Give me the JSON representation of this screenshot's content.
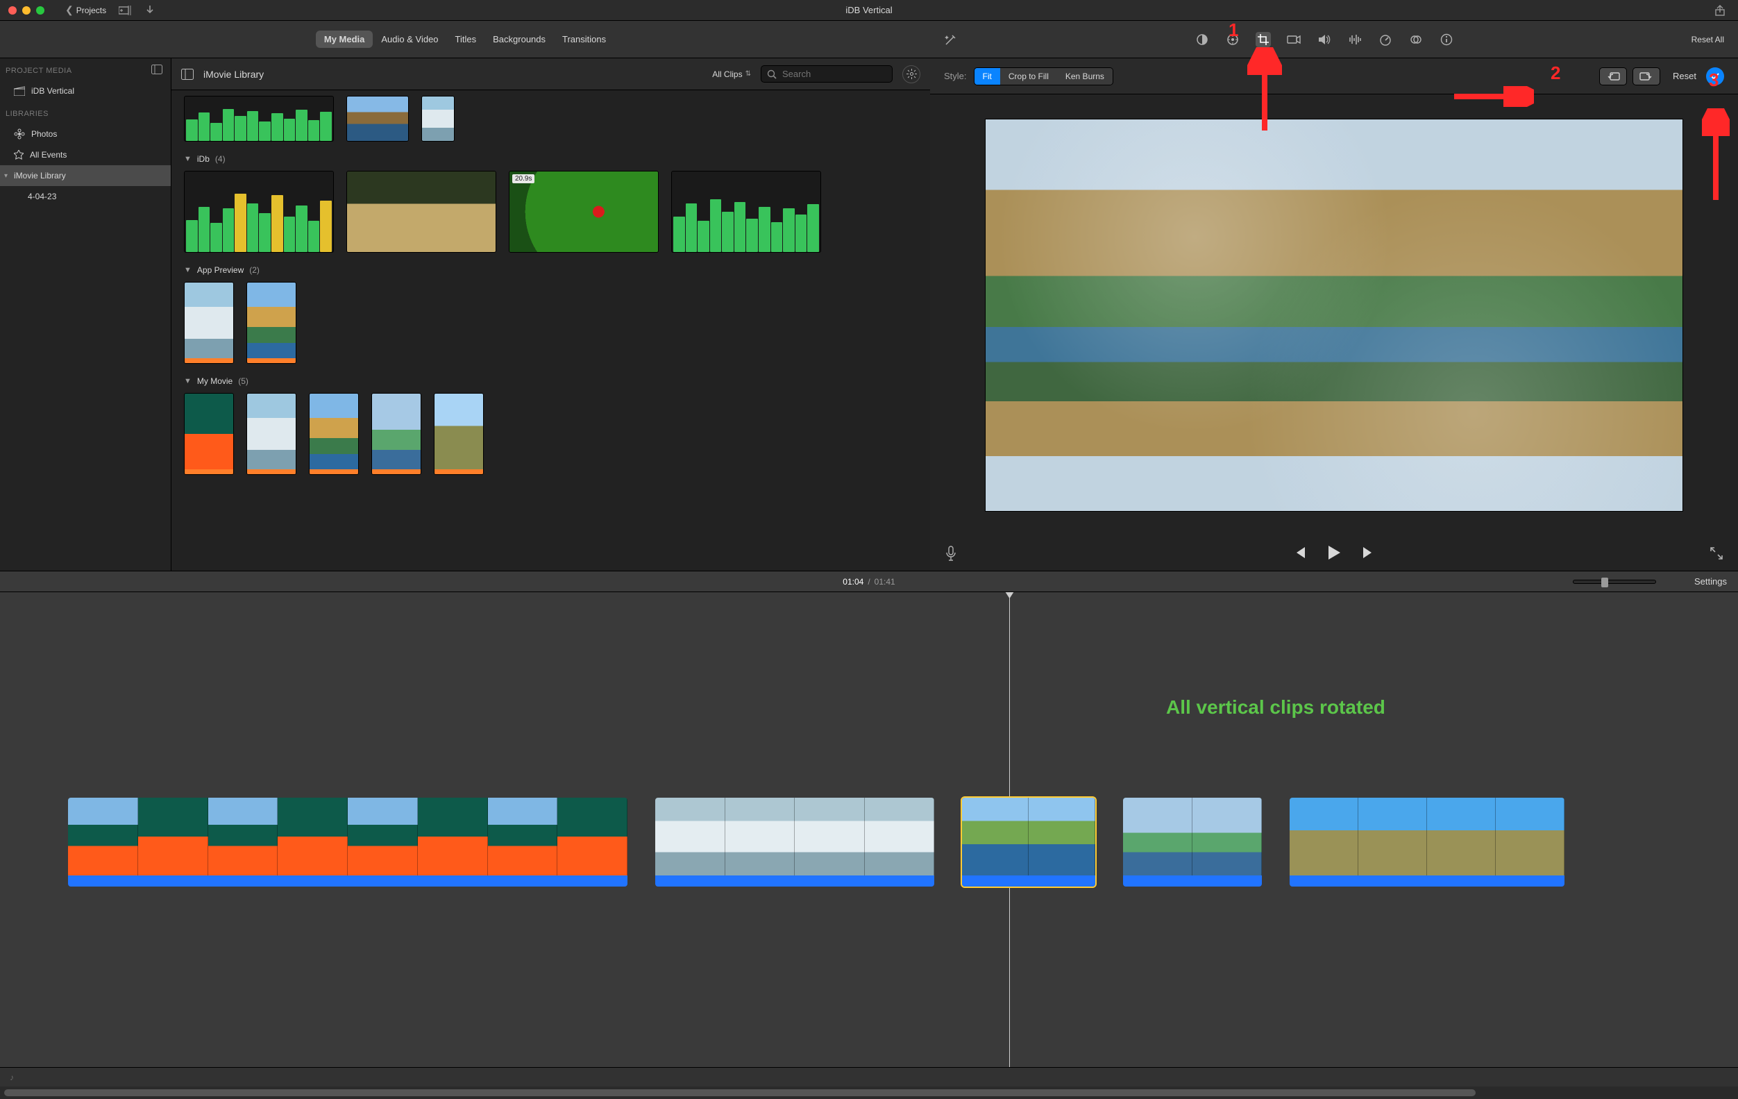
{
  "titlebar": {
    "projects_label": "Projects",
    "title": "iDB Vertical"
  },
  "ribbon": {
    "tabs": {
      "my_media": "My Media",
      "audio_video": "Audio & Video",
      "titles": "Titles",
      "backgrounds": "Backgrounds",
      "transitions": "Transitions"
    }
  },
  "sidebar": {
    "project_media_head": "PROJECT MEDIA",
    "project_item": "iDB Vertical",
    "libraries_head": "LIBRARIES",
    "photos_item": "Photos",
    "all_events_item": "All Events",
    "imovie_library_item": "iMovie Library",
    "imovie_date_item": "4-04-23"
  },
  "library": {
    "title": "iMovie Library",
    "allclips_label": "All Clips",
    "search_placeholder": "Search"
  },
  "events": {
    "idb": {
      "name": "iDb",
      "count": "(4)",
      "parrot_duration": "20.9s"
    },
    "app_preview": {
      "name": "App Preview",
      "count": "(2)"
    },
    "my_movie": {
      "name": "My Movie",
      "count": "(5)"
    }
  },
  "viewer": {
    "reset_all": "Reset All",
    "style_label": "Style:",
    "seg": {
      "fit": "Fit",
      "crop": "Crop to Fill",
      "kenburns": "Ken Burns"
    },
    "reset_label": "Reset"
  },
  "timeline": {
    "current": "01:04",
    "total": "01:41",
    "settings": "Settings",
    "annotation_text": "All vertical clips rotated"
  },
  "annot": {
    "n1": "1",
    "n2": "2",
    "n3": "3"
  }
}
